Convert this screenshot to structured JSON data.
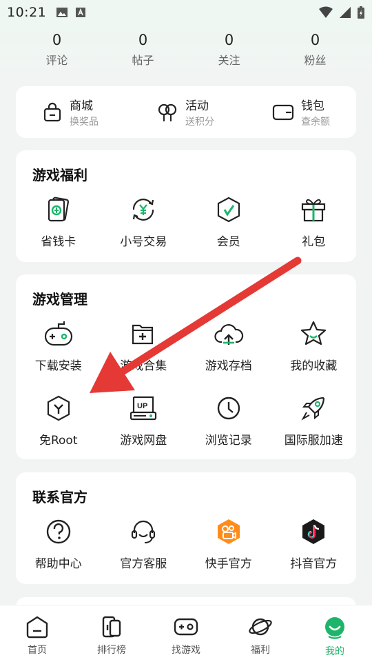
{
  "status_bar": {
    "time": "10:21"
  },
  "stats": [
    {
      "value": "0",
      "label": "评论"
    },
    {
      "value": "0",
      "label": "帖子"
    },
    {
      "value": "0",
      "label": "关注"
    },
    {
      "value": "0",
      "label": "粉丝"
    }
  ],
  "quick": [
    {
      "title": "商城",
      "sub": "换奖品",
      "icon": "shopping-bag-icon"
    },
    {
      "title": "活动",
      "sub": "送积分",
      "icon": "balloons-icon"
    },
    {
      "title": "钱包",
      "sub": "查余额",
      "icon": "wallet-icon"
    }
  ],
  "welfare": {
    "title": "游戏福利",
    "items": [
      {
        "label": "省钱卡",
        "icon": "money-card-icon"
      },
      {
        "label": "小号交易",
        "icon": "yuan-trade-icon"
      },
      {
        "label": "会员",
        "icon": "vip-shield-icon"
      },
      {
        "label": "礼包",
        "icon": "gift-icon"
      }
    ]
  },
  "manage": {
    "title": "游戏管理",
    "items": [
      {
        "label": "下载安装",
        "icon": "gamepad-icon"
      },
      {
        "label": "游戏合集",
        "icon": "folder-plus-icon"
      },
      {
        "label": "游戏存档",
        "icon": "cloud-upload-icon"
      },
      {
        "label": "我的收藏",
        "icon": "star-icon"
      },
      {
        "label": "免Root",
        "icon": "hexagon-y-icon"
      },
      {
        "label": "游戏网盘",
        "icon": "up-drive-icon"
      },
      {
        "label": "浏览记录",
        "icon": "clock-icon"
      },
      {
        "label": "国际服加速",
        "icon": "rocket-icon"
      }
    ]
  },
  "contact": {
    "title": "联系官方",
    "items": [
      {
        "label": "帮助中心",
        "icon": "question-icon"
      },
      {
        "label": "官方客服",
        "icon": "headset-icon"
      },
      {
        "label": "快手官方",
        "icon": "kuaishou-icon"
      },
      {
        "label": "抖音官方",
        "icon": "douyin-icon"
      }
    ]
  },
  "nav": [
    {
      "label": "首页",
      "icon": "home-icon",
      "active": false
    },
    {
      "label": "排行榜",
      "icon": "ranking-icon",
      "active": false
    },
    {
      "label": "找游戏",
      "icon": "find-game-icon",
      "active": false
    },
    {
      "label": "福利",
      "icon": "planet-icon",
      "active": false
    },
    {
      "label": "我的",
      "icon": "profile-icon",
      "active": true
    }
  ],
  "colors": {
    "accent": "#1db56a",
    "arrow": "#e53935",
    "card": "#ffffff",
    "background": "#f2f4f3"
  }
}
